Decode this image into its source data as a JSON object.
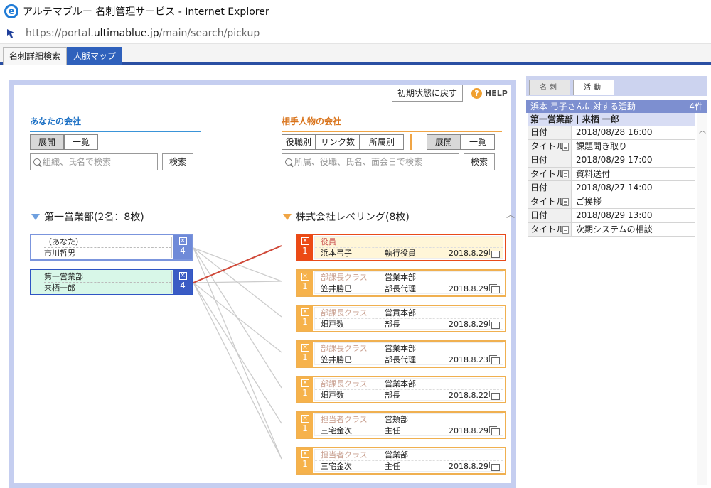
{
  "window": {
    "title": "アルテマブルー 名刺管理サービス - Internet Explorer",
    "icon": "ie-logo-icon"
  },
  "address": {
    "scheme": "https://portal.",
    "host": "ultimablue.jp",
    "path": "/main/search/pickup"
  },
  "app_tabs": [
    {
      "label": "名刺詳細検索",
      "active": false
    },
    {
      "label": "人脈マップ",
      "active": true
    }
  ],
  "toolbar": {
    "reset_label": "初期状態に戻す",
    "help_label": "HELP"
  },
  "left": {
    "section_title": "あなたの会社",
    "view_tabs": [
      "展開",
      "一覧"
    ],
    "search_placeholder": "組織、氏名で検索",
    "search_button": "検索",
    "group_title": "第一営業部(2名：8枚)",
    "cards": [
      {
        "line1": "（あなた）",
        "line2": "市川哲男",
        "count": "4"
      },
      {
        "line1": "第一営業部",
        "line2": "来栖一郎",
        "count": "4"
      }
    ]
  },
  "right": {
    "section_title": "相手人物の会社",
    "sort_tabs": [
      "役職別",
      "リンク数",
      "所属別"
    ],
    "view_tabs": [
      "展開",
      "一覧"
    ],
    "search_placeholder": "所属、役職、氏名、面会日で検索",
    "search_button": "検索",
    "group_title": "株式会社レベリング(8枚)",
    "cards": [
      {
        "count": "1",
        "rank": "役員",
        "dept": "",
        "name": "浜本弓子",
        "position": "執行役員",
        "date": "2018.8.29"
      },
      {
        "count": "1",
        "rank": "部課長クラス",
        "dept": "営業本部",
        "name": "笠井勝巳",
        "position": "部長代理",
        "date": "2018.8.29"
      },
      {
        "count": "1",
        "rank": "部課長クラス",
        "dept": "営貢本部",
        "name": "畑戸数",
        "position": "部長",
        "date": "2018.8.29"
      },
      {
        "count": "1",
        "rank": "部課長クラス",
        "dept": "営業本部",
        "name": "笠井勝巳",
        "position": "部長代理",
        "date": "2018.8.23"
      },
      {
        "count": "1",
        "rank": "部課長クラス",
        "dept": "営業本部",
        "name": "畑戸数",
        "position": "部長",
        "date": "2018.8.22"
      },
      {
        "count": "1",
        "rank": "担当者クラス",
        "dept": "営頬部",
        "name": "三宅金次",
        "position": "主任",
        "date": "2018.8.29"
      },
      {
        "count": "1",
        "rank": "担当者クラス",
        "dept": "営業部",
        "name": "三宅金次",
        "position": "主任",
        "date": "2018.8.29"
      }
    ]
  },
  "panel": {
    "tabs": [
      "名刺",
      "活動"
    ],
    "header": "浜本 弓子さんに対する活動",
    "count": "4件",
    "subheader": "第一営業部 | 来栖 一郎",
    "activities": [
      {
        "date_key": "日付",
        "date": "2018/08/28 16:00",
        "title_key": "タイトル",
        "title": "課題聞き取り"
      },
      {
        "date_key": "日付",
        "date": "2018/08/29 17:00",
        "title_key": "タイトル",
        "title": "資料送付"
      },
      {
        "date_key": "日付",
        "date": "2018/08/27 14:00",
        "title_key": "タイトル",
        "title": "ご挨拶"
      },
      {
        "date_key": "日付",
        "date": "2018/08/29 13:00",
        "title_key": "タイトル",
        "title": "次期システムの相談"
      }
    ]
  },
  "colors": {
    "accent_blue": "#2f61bc",
    "link_line": "#d04a3a",
    "orange": "#f0a545"
  }
}
